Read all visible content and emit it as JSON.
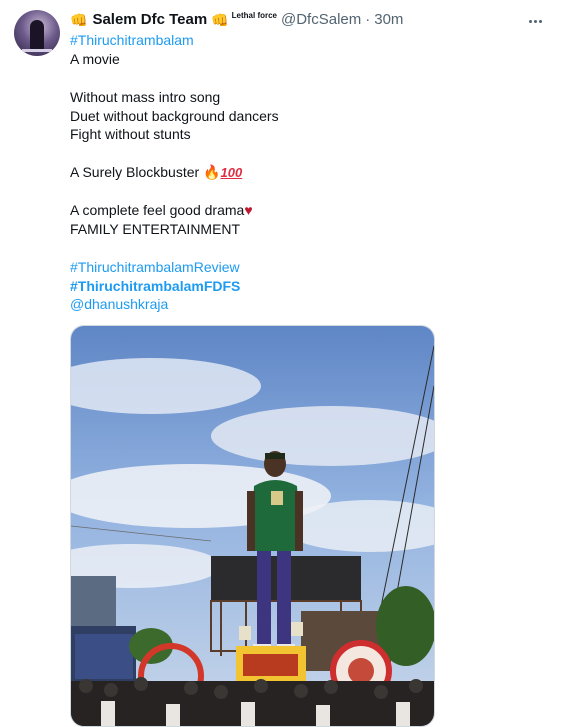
{
  "tweet": {
    "name": "Salem Dfc Team",
    "name_prefix_emoji": "👊",
    "name_suffix_emoji": "👊",
    "badge": "Lethal force",
    "handle": "@DfcSalem",
    "dot": "·",
    "time": "30m",
    "more_icon": "more-horizontal-icon",
    "lines": {
      "hashtag1": "#Thiruchitrambalam",
      "l1": "A movie",
      "l2": "Without mass intro song",
      "l3": "Duet without background dancers",
      "l4": "Fight without stunts",
      "l5": "A Surely Blockbuster",
      "fire": "🔥",
      "hundred": "100",
      "l6": "A complete feel good drama",
      "heart": "♥",
      "l7": "FAMILY ENTERTAINMENT",
      "hashtag2": "#ThiruchitrambalamReview",
      "hashtag3": "#ThiruchitrambalamFDFS",
      "mention": "@dhanushkraja"
    }
  },
  "colors": {
    "link": "#1d9bf0",
    "secondary_text": "#536471",
    "primary_text": "#0f1419"
  }
}
